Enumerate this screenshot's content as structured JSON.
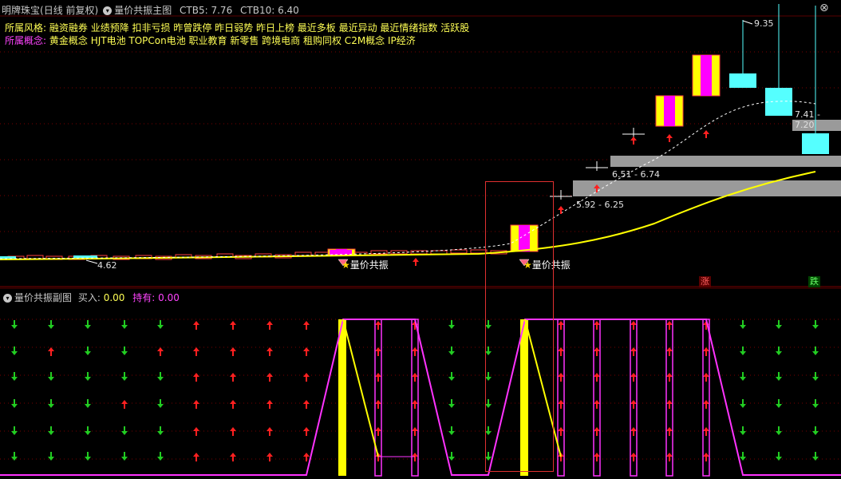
{
  "main_header": {
    "title": "明牌珠宝",
    "period": "(日线 前复权)",
    "indicator": "量价共振主图",
    "ctb5_label": "CTB5: 7.76",
    "ctb10_label": "CTB10: 6.40"
  },
  "style_line": {
    "label": "所属风格:",
    "value": "融资融券 业绩预降 扣非亏损 昨曾跌停 昨日弱势 昨日上榜 最近多板 最近异动 最近情绪指数 活跃股"
  },
  "concept_line": {
    "label": "所属概念:",
    "value": "黄金概念 HJT电池 TOPCon电池 职业教育 新零售 跨境电商 租购同权 C2M概念 IP经济"
  },
  "price_labels": {
    "high": "9.35",
    "low": "4.62",
    "zone1": "5.92 - 6.25",
    "zone2": "6.51 - 6.74",
    "zone3": "7.41 - 7.20"
  },
  "signals": {
    "signal1": "量价共振",
    "signal2": "量价共振"
  },
  "tags": {
    "up": "涨",
    "down": "跌"
  },
  "sub_header": {
    "indicator": "量价共振副图",
    "buy_label": "买入:",
    "buy_value": "0.00",
    "hold_label": "持有:",
    "hold_value": "0.00"
  },
  "colors": {
    "up": "#ff2020",
    "down": "#22cc22",
    "accent_magenta": "#ff33ff",
    "accent_yellow": "#ffff00",
    "cyan": "#55ffff",
    "zone_gray": "#9a9a9a"
  }
}
